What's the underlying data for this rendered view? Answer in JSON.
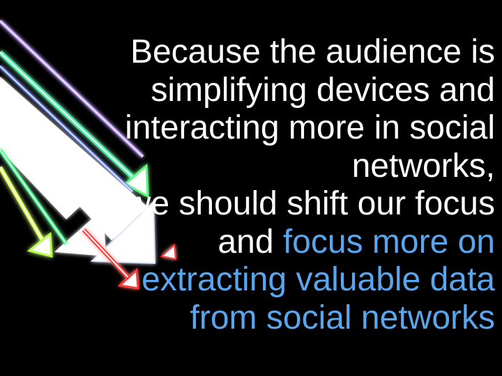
{
  "slide": {
    "lines": [
      {
        "text": "Because the audience is"
      },
      {
        "text": "simplifying devices and"
      },
      {
        "text": "interacting more in social"
      },
      {
        "text": "networks,"
      },
      {
        "text": "we should shift our focus"
      },
      {
        "plain": "and ",
        "highlight": "focus more on"
      },
      {
        "highlight": "extracting valuable data"
      },
      {
        "highlight": "from social networks"
      }
    ]
  },
  "colors": {
    "background": "#000000",
    "text": "#ffffff",
    "accent": "#5aa6ee",
    "glow_purple": "#8a5cff",
    "glow_green": "#59ff7a",
    "glow_red": "#ff3b3b",
    "glow_yellow": "#e6ff5a"
  },
  "decoration": {
    "icon": "glowing-arrows-graphic"
  }
}
